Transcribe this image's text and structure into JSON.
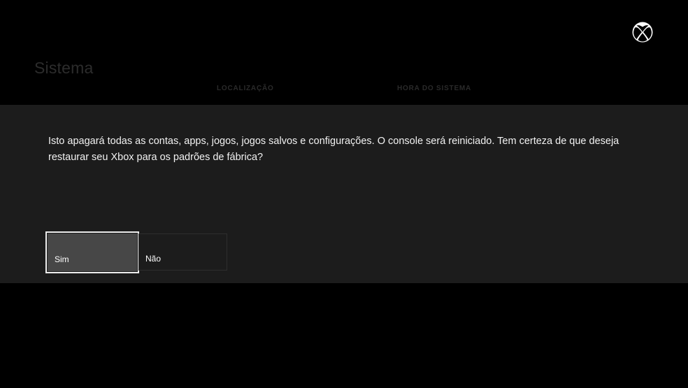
{
  "background": {
    "title": "Sistema",
    "tabs": [
      "LOCALIZAÇÃO",
      "HORA DO SISTEMA"
    ]
  },
  "logo_icon": "xbox-logo-icon",
  "dialog": {
    "message": "Isto apagará todas as contas, apps, jogos, jogos salvos e configurações. O console será reiniciado. Tem certeza de que deseja restaurar seu Xbox para os padrões de fábrica?",
    "buttons": {
      "yes": "Sim",
      "no": "Não"
    },
    "focused_button": "Sim"
  },
  "colors": {
    "background": "#000000",
    "dialog_background": "#1c1c1c",
    "focused_button_background": "#474747",
    "focus_border": "#ececec"
  }
}
